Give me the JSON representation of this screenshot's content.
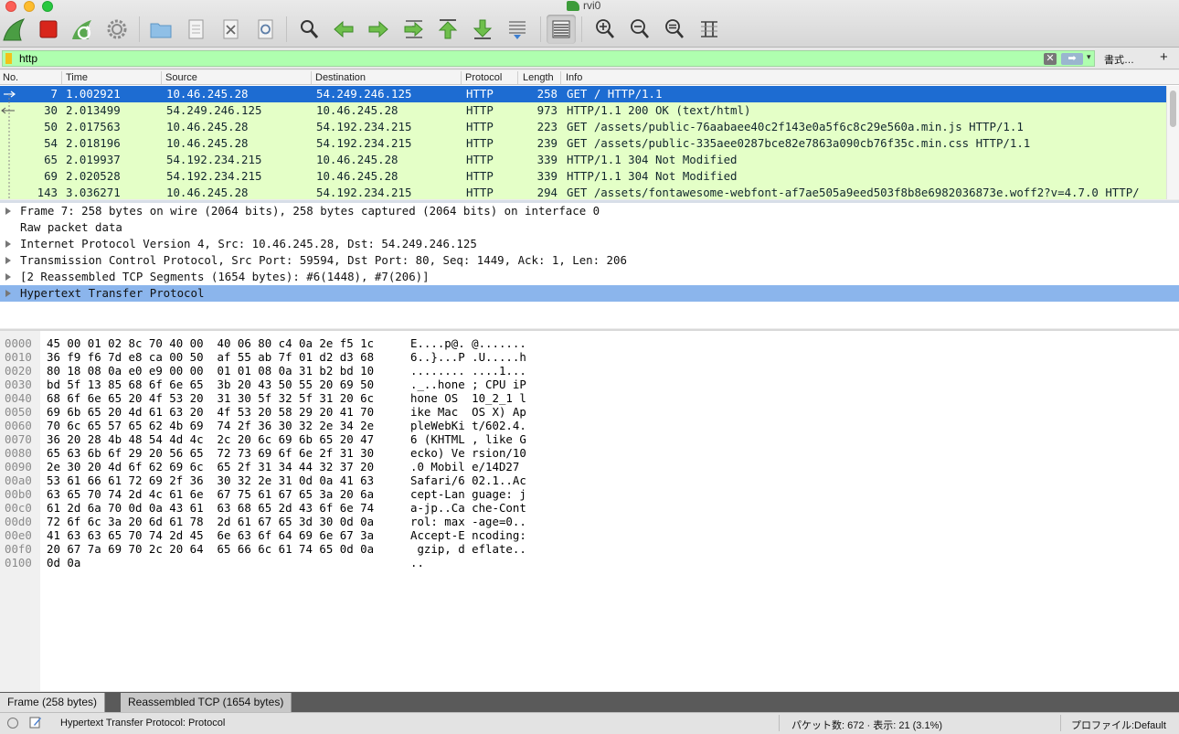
{
  "window": {
    "title": "rvi0"
  },
  "toolbar": {
    "buttons": [
      {
        "icon": "shark-fin-icon"
      },
      {
        "icon": "stop-icon"
      },
      {
        "icon": "restart-icon"
      },
      {
        "icon": "gear-icon"
      },
      {
        "icon": "folder-icon"
      },
      {
        "icon": "save-file-icon"
      },
      {
        "icon": "close-file-icon"
      },
      {
        "icon": "reload-icon"
      },
      {
        "icon": "search-icon"
      },
      {
        "icon": "arrow-left-icon"
      },
      {
        "icon": "arrow-right-icon"
      },
      {
        "icon": "go-to-packet-icon"
      },
      {
        "icon": "first-packet-icon"
      },
      {
        "icon": "last-packet-icon"
      },
      {
        "icon": "autoscroll-icon"
      },
      {
        "icon": "colorize-icon"
      },
      {
        "icon": "zoom-in-icon"
      },
      {
        "icon": "zoom-out-icon"
      },
      {
        "icon": "zoom-normal-icon"
      },
      {
        "icon": "resize-columns-icon"
      }
    ]
  },
  "filter": {
    "value": "http",
    "clear_glyph": "✕",
    "apply_glyph": "➡",
    "dropdown_glyph": "▾",
    "format_label": "書式…",
    "add_label": "+"
  },
  "packet_list": {
    "columns": [
      "No.",
      "Time",
      "Source",
      "Destination",
      "Protocol",
      "Length",
      "Info"
    ],
    "rows": [
      {
        "no": "7",
        "time": "1.002921",
        "src": "10.46.245.28",
        "dst": "54.249.246.125",
        "proto": "HTTP",
        "len": "258",
        "info": "GET / HTTP/1.1"
      },
      {
        "no": "30",
        "time": "2.013499",
        "src": "54.249.246.125",
        "dst": "10.46.245.28",
        "proto": "HTTP",
        "len": "973",
        "info": "HTTP/1.1 200 OK  (text/html)"
      },
      {
        "no": "50",
        "time": "2.017563",
        "src": "10.46.245.28",
        "dst": "54.192.234.215",
        "proto": "HTTP",
        "len": "223",
        "info": "GET /assets/public-76aabaee40c2f143e0a5f6c8c29e560a.min.js HTTP/1.1"
      },
      {
        "no": "54",
        "time": "2.018196",
        "src": "10.46.245.28",
        "dst": "54.192.234.215",
        "proto": "HTTP",
        "len": "239",
        "info": "GET /assets/public-335aee0287bce82e7863a090cb76f35c.min.css HTTP/1.1"
      },
      {
        "no": "65",
        "time": "2.019937",
        "src": "54.192.234.215",
        "dst": "10.46.245.28",
        "proto": "HTTP",
        "len": "339",
        "info": "HTTP/1.1 304 Not Modified"
      },
      {
        "no": "69",
        "time": "2.020528",
        "src": "54.192.234.215",
        "dst": "10.46.245.28",
        "proto": "HTTP",
        "len": "339",
        "info": "HTTP/1.1 304 Not Modified"
      },
      {
        "no": "143",
        "time": "3.036271",
        "src": "10.46.245.28",
        "dst": "54.192.234.215",
        "proto": "HTTP",
        "len": "294",
        "info": "GET /assets/fontawesome-webfont-af7ae505a9eed503f8b8e6982036873e.woff2?v=4.7.0 HTTP/"
      }
    ]
  },
  "details": {
    "rows": [
      {
        "text": "Frame 7: 258 bytes on wire (2064 bits), 258 bytes captured (2064 bits) on interface 0",
        "expandable": true
      },
      {
        "text": "Raw packet data",
        "expandable": false
      },
      {
        "text": "Internet Protocol Version 4, Src: 10.46.245.28, Dst: 54.249.246.125",
        "expandable": true
      },
      {
        "text": "Transmission Control Protocol, Src Port: 59594, Dst Port: 80, Seq: 1449, Ack: 1, Len: 206",
        "expandable": true
      },
      {
        "text": "[2 Reassembled TCP Segments (1654 bytes): #6(1448), #7(206)]",
        "expandable": true
      },
      {
        "text": "Hypertext Transfer Protocol",
        "expandable": true
      }
    ]
  },
  "bytes": {
    "rows": [
      {
        "off": "0000",
        "hex": "45 00 01 02 8c 70 40 00  40 06 80 c4 0a 2e f5 1c",
        "ascii": "E....p@. @......."
      },
      {
        "off": "0010",
        "hex": "36 f9 f6 7d e8 ca 00 50  af 55 ab 7f 01 d2 d3 68",
        "ascii": "6..}...P .U.....h"
      },
      {
        "off": "0020",
        "hex": "80 18 08 0a e0 e9 00 00  01 01 08 0a 31 b2 bd 10",
        "ascii": "........ ....1..."
      },
      {
        "off": "0030",
        "hex": "bd 5f 13 85 68 6f 6e 65  3b 20 43 50 55 20 69 50",
        "ascii": "._..hone ; CPU iP"
      },
      {
        "off": "0040",
        "hex": "68 6f 6e 65 20 4f 53 20  31 30 5f 32 5f 31 20 6c",
        "ascii": "hone OS  10_2_1 l"
      },
      {
        "off": "0050",
        "hex": "69 6b 65 20 4d 61 63 20  4f 53 20 58 29 20 41 70",
        "ascii": "ike Mac  OS X) Ap"
      },
      {
        "off": "0060",
        "hex": "70 6c 65 57 65 62 4b 69  74 2f 36 30 32 2e 34 2e",
        "ascii": "pleWebKi t/602.4."
      },
      {
        "off": "0070",
        "hex": "36 20 28 4b 48 54 4d 4c  2c 20 6c 69 6b 65 20 47",
        "ascii": "6 (KHTML , like G"
      },
      {
        "off": "0080",
        "hex": "65 63 6b 6f 29 20 56 65  72 73 69 6f 6e 2f 31 30",
        "ascii": "ecko) Ve rsion/10"
      },
      {
        "off": "0090",
        "hex": "2e 30 20 4d 6f 62 69 6c  65 2f 31 34 44 32 37 20",
        "ascii": ".0 Mobil e/14D27 "
      },
      {
        "off": "00a0",
        "hex": "53 61 66 61 72 69 2f 36  30 32 2e 31 0d 0a 41 63",
        "ascii": "Safari/6 02.1..Ac"
      },
      {
        "off": "00b0",
        "hex": "63 65 70 74 2d 4c 61 6e  67 75 61 67 65 3a 20 6a",
        "ascii": "cept-Lan guage: j"
      },
      {
        "off": "00c0",
        "hex": "61 2d 6a 70 0d 0a 43 61  63 68 65 2d 43 6f 6e 74",
        "ascii": "a-jp..Ca che-Cont"
      },
      {
        "off": "00d0",
        "hex": "72 6f 6c 3a 20 6d 61 78  2d 61 67 65 3d 30 0d 0a",
        "ascii": "rol: max -age=0.."
      },
      {
        "off": "00e0",
        "hex": "41 63 63 65 70 74 2d 45  6e 63 6f 64 69 6e 67 3a",
        "ascii": "Accept-E ncoding:"
      },
      {
        "off": "00f0",
        "hex": "20 67 7a 69 70 2c 20 64  65 66 6c 61 74 65 0d 0a",
        "ascii": " gzip, d eflate.."
      },
      {
        "off": "0100",
        "hex": "0d 0a",
        "ascii": ".."
      }
    ]
  },
  "tabs": {
    "frame": "Frame (258 bytes)",
    "reassembled": "Reassembled TCP (1654 bytes)"
  },
  "status": {
    "field": "Hypertext Transfer Protocol: Protocol",
    "packets": "パケット数: 672 · 表示: 21 (3.1%)",
    "profile": "プロファイル:Default"
  },
  "colors": {
    "selected_row": "#1d6cd2",
    "http_row": "#e4ffc7",
    "filter_valid": "#afffaf",
    "selected_detail": "#8bb5ec"
  }
}
